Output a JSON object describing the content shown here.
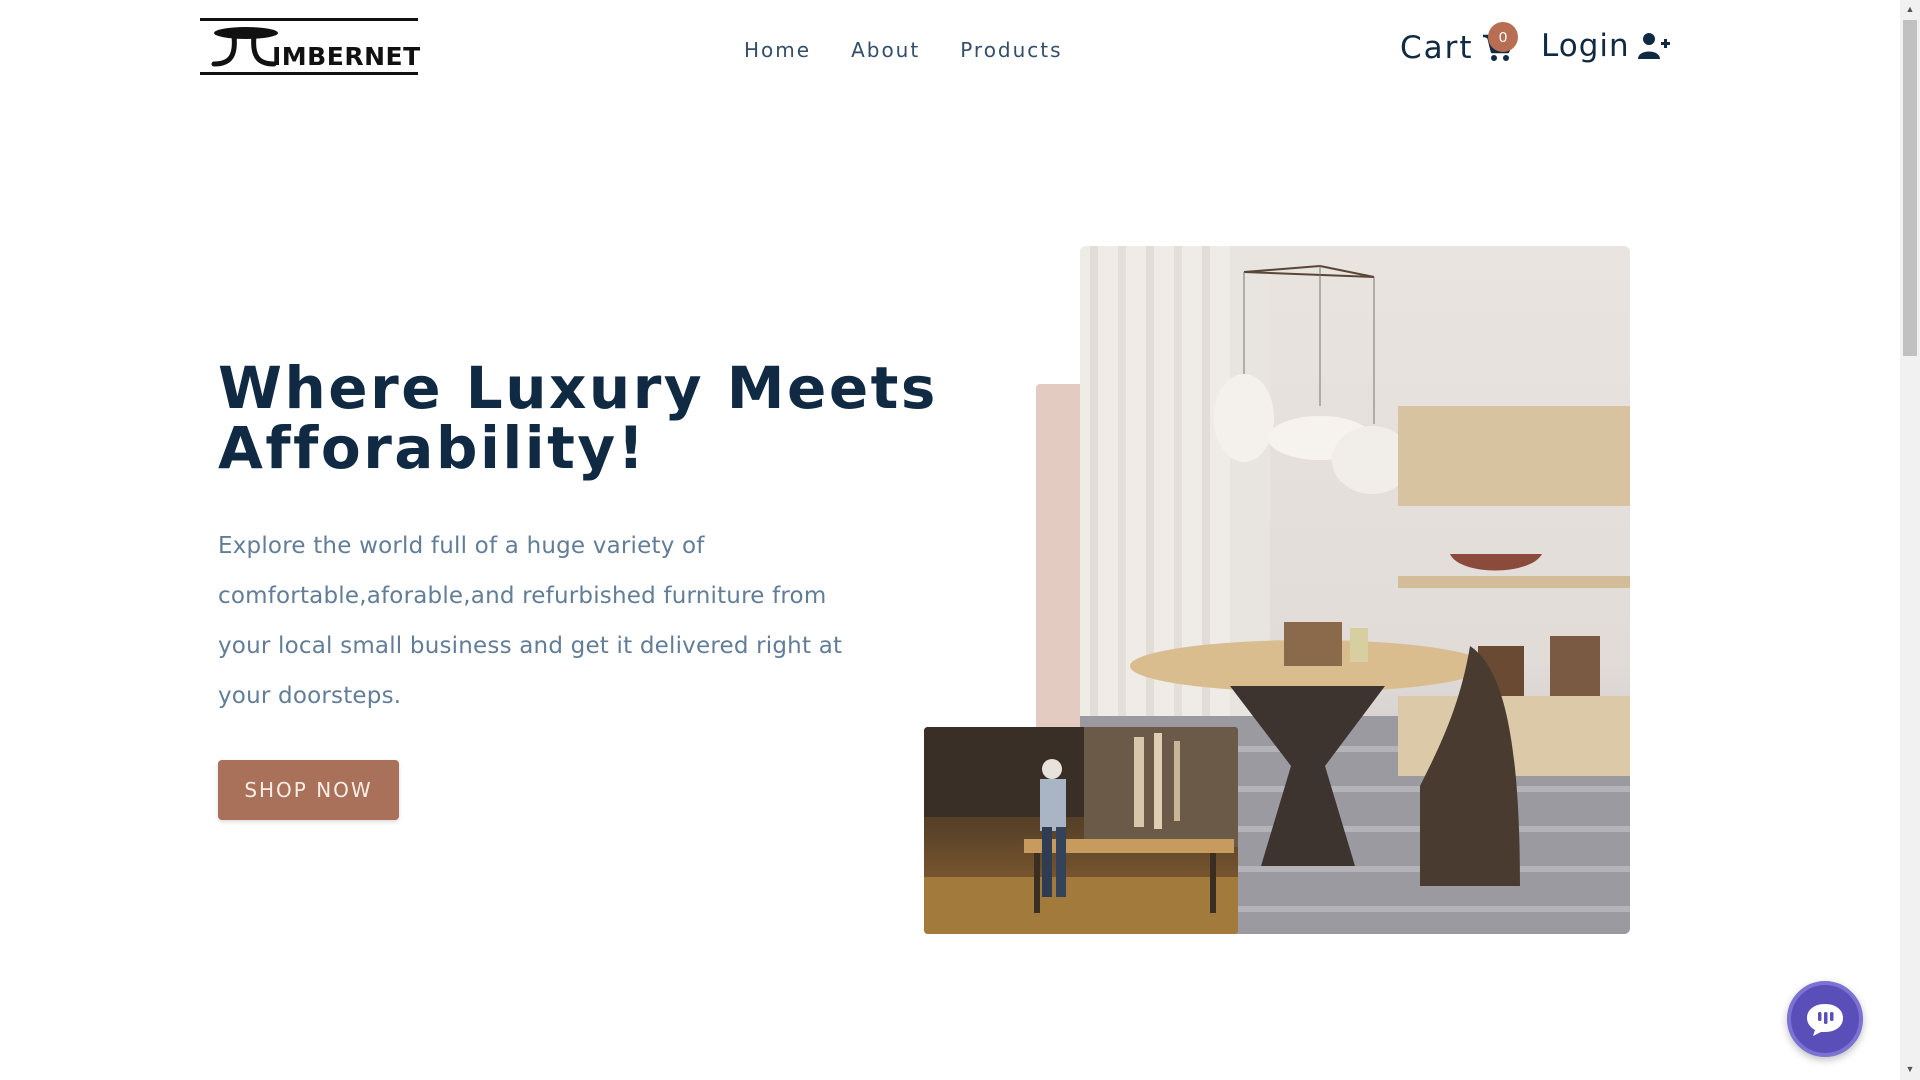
{
  "brand": {
    "logo_text": "IMBERNET"
  },
  "nav": {
    "links": [
      {
        "label": "Home"
      },
      {
        "label": "About"
      },
      {
        "label": "Products"
      }
    ],
    "cart_label": "Cart",
    "cart_count": "0",
    "login_label": "Login"
  },
  "hero": {
    "title": "Where Luxury Meets Afforability!",
    "description": "Explore the world full of a huge variety of comfortable,aforable,and refurbished furniture from your local small business and get it delivered right at your doorsteps.",
    "cta_label": "SHOP NOW"
  },
  "colors": {
    "heading": "#102a43",
    "body_text": "#627d98",
    "accent": "#a9705a",
    "badge": "#b76e53",
    "chat": "#5a4fb8"
  },
  "icons": {
    "cart": "shopping-cart-icon",
    "login": "user-plus-icon",
    "chat": "chat-bubble-icon"
  }
}
